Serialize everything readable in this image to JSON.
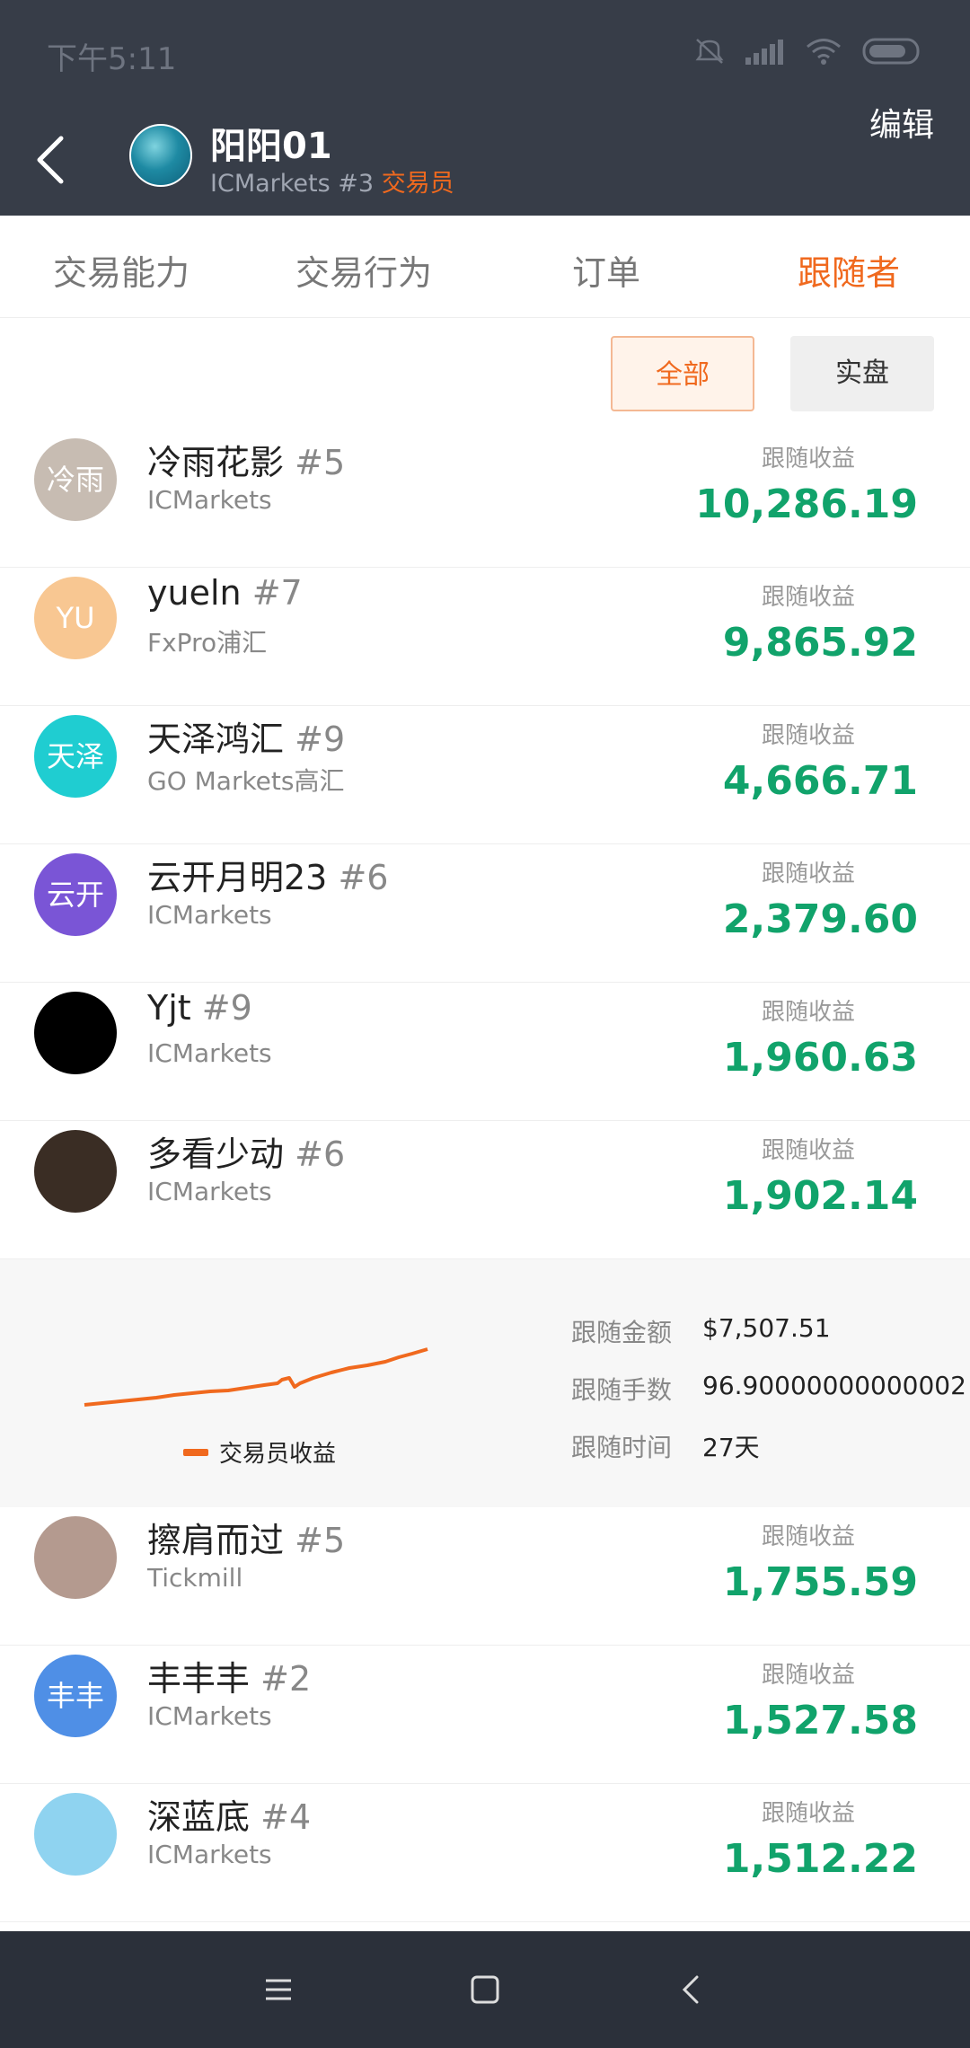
{
  "status": {
    "time": "下午5:11"
  },
  "header": {
    "title": "阳阳01",
    "broker": "ICMarkets #3",
    "role": "交易员",
    "edit_label": "编辑"
  },
  "tabs": [
    {
      "label": "交易能力"
    },
    {
      "label": "交易行为"
    },
    {
      "label": "订单"
    },
    {
      "label": "跟随者"
    }
  ],
  "filters": {
    "all": "全部",
    "real": "实盘"
  },
  "earnings_label": "跟随收益",
  "followers": [
    {
      "name": "冷雨花影",
      "rank": "#5",
      "broker": "ICMarkets",
      "earnings": "10,286.19",
      "avatar_text": "冷雨",
      "avatar_color": "#c7bcb2"
    },
    {
      "name": "yueln",
      "rank": "#7",
      "broker": "FxPro浦汇",
      "earnings": "9,865.92",
      "avatar_text": "YU",
      "avatar_color": "#f8c792"
    },
    {
      "name": "天泽鸿汇",
      "rank": "#9",
      "broker": "GO Markets高汇",
      "earnings": "4,666.71",
      "avatar_text": "天泽",
      "avatar_color": "#1fcdd1"
    },
    {
      "name": "云开月明23",
      "rank": "#6",
      "broker": "ICMarkets",
      "earnings": "2,379.60",
      "avatar_text": "云开",
      "avatar_color": "#7a55d6"
    },
    {
      "name": "Yjt",
      "rank": "#9",
      "broker": "ICMarkets",
      "earnings": "1,960.63",
      "avatar_text": "",
      "avatar_color": "#000000"
    },
    {
      "name": "多看少动",
      "rank": "#6",
      "broker": "ICMarkets",
      "earnings": "1,902.14",
      "avatar_text": "",
      "avatar_color": "#3a2d24"
    }
  ],
  "detail": {
    "legend": "交易员收益",
    "stats": [
      {
        "key": "跟随金额",
        "value": "$7,507.51"
      },
      {
        "key": "跟随手数",
        "value": "96.90000000000002"
      },
      {
        "key": "跟随时间",
        "value": "27天"
      }
    ]
  },
  "followers_more": [
    {
      "name": "擦肩而过",
      "rank": "#5",
      "broker": "Tickmill",
      "earnings": "1,755.59",
      "avatar_text": "",
      "avatar_color": "#b49a8f"
    },
    {
      "name": "丰丰丰",
      "rank": "#2",
      "broker": "ICMarkets",
      "earnings": "1,527.58",
      "avatar_text": "丰丰",
      "avatar_color": "#4f8fe6"
    },
    {
      "name": "深蓝底",
      "rank": "#4",
      "broker": "ICMarkets",
      "earnings": "1,512.22",
      "avatar_text": "",
      "avatar_color": "#8fd3f0"
    }
  ],
  "colors": {
    "accent": "#f0691e",
    "positive": "#11a36b",
    "header_bg": "#373d48"
  }
}
